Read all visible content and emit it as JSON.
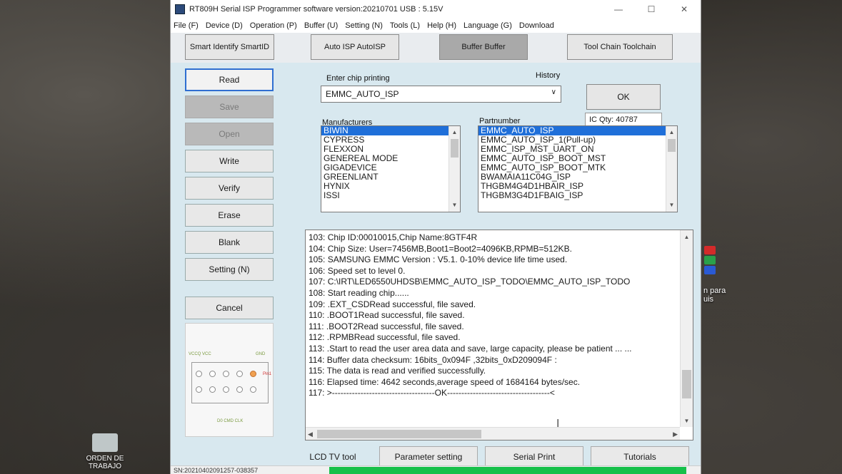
{
  "window": {
    "title": "RT809H Serial ISP Programmer software version:20210701  USB : 5.15V",
    "controls": [
      "—",
      "☐",
      "✕"
    ]
  },
  "menu": [
    "File (F)",
    "Device (D)",
    "Operation (P)",
    "Buffer (U)",
    "Setting (N)",
    "Tools (L)",
    "Help (H)",
    "Language (G)",
    "Download"
  ],
  "toolbar": {
    "smart_identify": "Smart Identify SmartID",
    "auto_isp": "Auto ISP AutoISP",
    "buffer": "Buffer Buffer",
    "toolchain": "Tool Chain Toolchain"
  },
  "sidebar": {
    "read": "Read",
    "save": "Save",
    "open": "Open",
    "write": "Write",
    "verify": "Verify",
    "erase": "Erase",
    "blank": "Blank",
    "setting": "Setting (N)",
    "cancel": "Cancel"
  },
  "chip": {
    "enter_label": "Enter chip printing",
    "history_label": "History",
    "value": "EMMC_AUTO_ISP",
    "ok": "OK",
    "ic_qty": "IC Qty: 40787",
    "manufacturers_label": "Manufacturers",
    "partnumber_label": "Partnumber"
  },
  "manufacturers": [
    "BIWIN",
    "CYPRESS",
    "FLEXXON",
    "GENEREAL MODE",
    "GIGADEVICE",
    "GREENLIANT",
    "HYNIX",
    "ISSI"
  ],
  "partnumbers": [
    "EMMC_AUTO_ISP",
    "EMMC_AUTO_ISP_1(Pull-up)",
    "EMMC_ISP_MST_UART_ON",
    "EMMC_AUTO_ISP_BOOT_MST",
    "EMMC_AUTO_ISP_BOOT_MTK",
    "BWAMAIA11C04G_ISP",
    "THGBM4G4D1HBAIR_ISP",
    "THGBM3G4D1FBAIG_ISP"
  ],
  "log": [
    "103: Chip ID:00010015,Chip Name:8GTF4R",
    "104: Chip Size: User=7456MB,Boot1=Boot2=4096KB,RPMB=512KB.",
    "105: SAMSUNG EMMC Version : V5.1.  0-10% device life time used.",
    "106: Speed set to level 0.",
    "107: C:\\IRT\\LED6550UHDSB\\EMMC_AUTO_ISP_TODO\\EMMC_AUTO_ISP_TODO",
    "108: Start reading chip......",
    "109: .EXT_CSDRead successful, file saved.",
    "110: .BOOT1Read successful, file saved.",
    "111: .BOOT2Read successful, file saved.",
    "112: .RPMBRead successful, file saved.",
    "113: .Start to read the user area data and save, large capacity, please be patient ... ...",
    "114: Buffer data checksum: 16bits_0x094F ,32bits_0xD209094F :",
    "115: The data is read and verified successfully.",
    "116: Elapsed time: 4642 seconds,average speed of 1684164 bytes/sec.",
    "117: >------------------------------------OK------------------------------------<"
  ],
  "bottom_tabs": {
    "lcd": "LCD TV tool",
    "param": "Parameter setting",
    "serial": "Serial Print",
    "tutorials": "Tutorials"
  },
  "status": {
    "serial": "SN:20210402091257-038357"
  },
  "pin_labels": {
    "vccq_vcc": "VCCQ VCC",
    "gnd": "GND",
    "pin1": "Pin1",
    "d0_cmd_clk": "D0  CMD  CLK"
  },
  "desktop": {
    "orden": "ORDEN DE TRABAJO",
    "para": "n para",
    "uis": "uis"
  },
  "progress": 1.0,
  "colors": {
    "selection": "#1f6fd9",
    "progress": "#17c04a",
    "panel": "#d8e8ef"
  }
}
